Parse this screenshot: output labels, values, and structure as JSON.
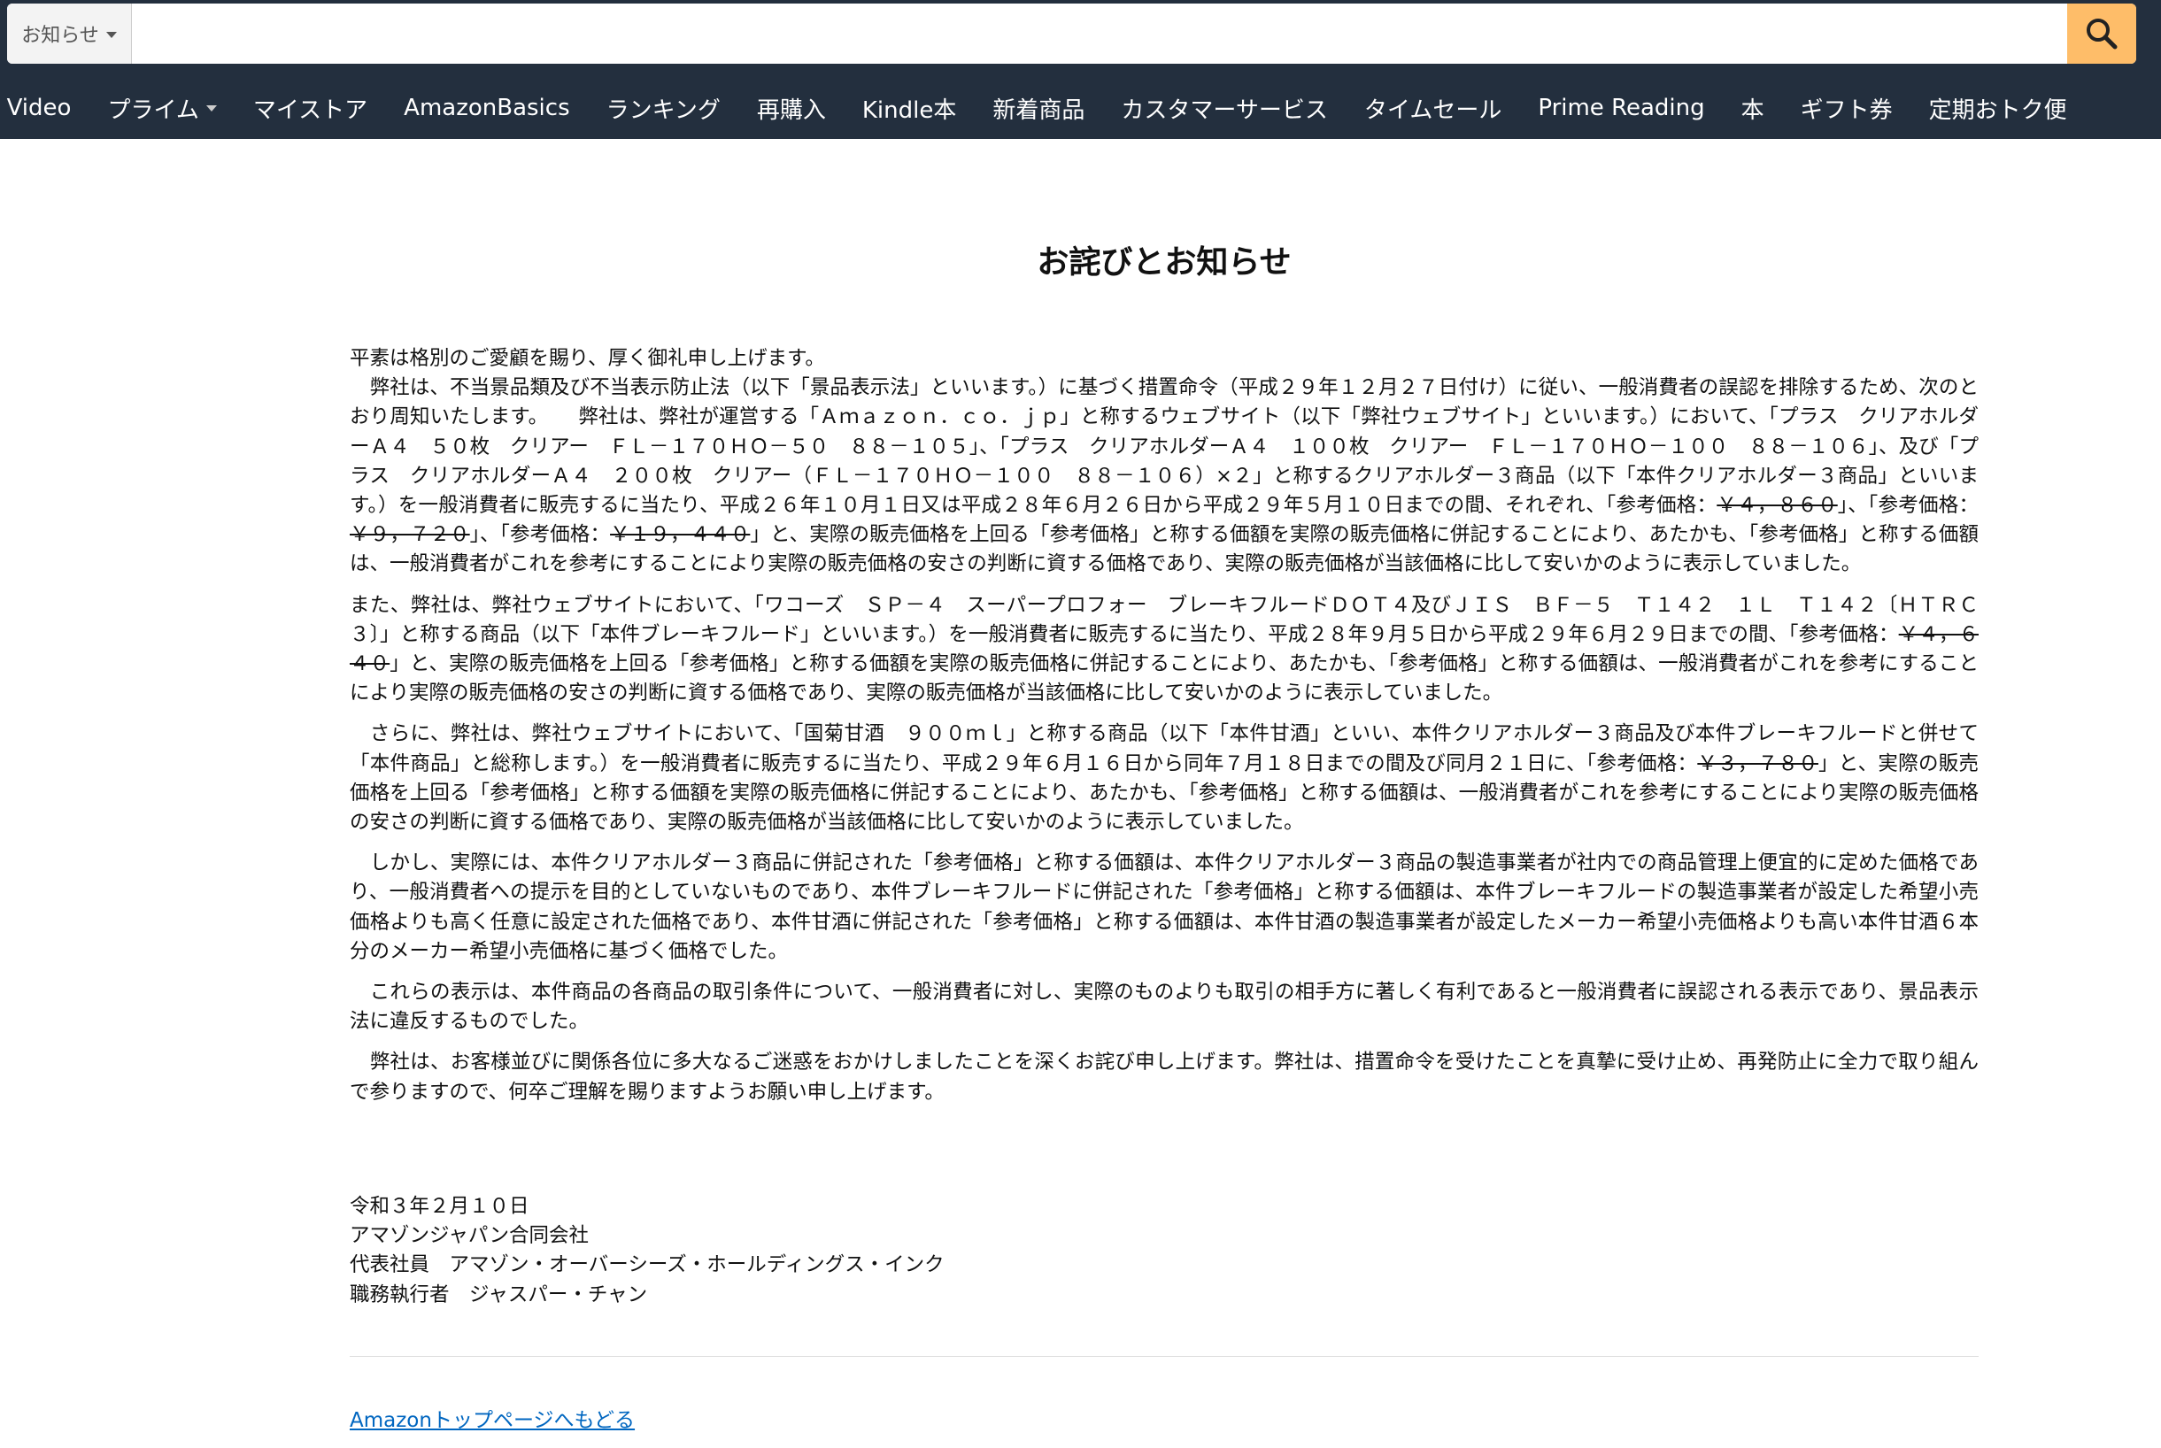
{
  "header": {
    "search": {
      "category": "お知らせ",
      "value": "",
      "placeholder": ""
    },
    "nav_items": [
      {
        "label": "me Video"
      },
      {
        "label": "プライム",
        "has_dropdown": true
      },
      {
        "label": "マイストア"
      },
      {
        "label": "AmazonBasics"
      },
      {
        "label": "ランキング"
      },
      {
        "label": "再購入"
      },
      {
        "label": "Kindle本"
      },
      {
        "label": "新着商品"
      },
      {
        "label": "カスタマーサービス"
      },
      {
        "label": "タイムセール"
      },
      {
        "label": "Prime Reading"
      },
      {
        "label": "本"
      },
      {
        "label": "ギフト券"
      },
      {
        "label": "定期おトク便"
      }
    ]
  },
  "colors": {
    "header_bg": "#232f3e",
    "search_button": "#febd69",
    "link": "#0066c0"
  },
  "main": {
    "title": "お詫びとお知らせ",
    "p1": {
      "line1": "平素は格別のご愛顧を賜り、厚く御礼申し上げます。",
      "a": "　弊社は、不当景品類及び不当表示防止法（以下「景品表示法」といいます。）に基づく措置命令（平成２９年１２月２７日付け）に従い、一般消費者の誤認を排除するため、次のとおり周知いたします。　　弊社は、弊社が運営する「Ａｍａｚｏｎ．ｃｏ．ｊｐ」と称するウェブサイト（以下「弊社ウェブサイト」といいます。）において、「プラス　クリアホルダーＡ４　５０枚　クリアー　ＦＬ－１７０ＨＯ－５０　８８－１０５」、「プラス　クリアホルダーＡ４　１００枚　クリアー　ＦＬ－１７０ＨＯ－１００　８８－１０６」、及び「プラス　クリアホルダーＡ４　２００枚　クリアー（ＦＬ－１７０ＨＯ－１００　８８－１０６）×２」と称するクリアホルダー３商品（以下「本件クリアホルダー３商品」といいます。）を一般消費者に販売するに当たり、平成２６年１０月１日又は平成２８年６月２６日から平成２９年５月１０日までの間、それぞれ、「参考価格：",
      "s1": "￥４，８６０",
      "b": "」、「参考価格：",
      "s2": "￥９，７２０",
      "c": "」、「参考価格：",
      "s3": "￥１９，４４０",
      "d": "」と、実際の販売価格を上回る「参考価格」と称する価額を実際の販売価格に併記することにより、あたかも、「参考価格」と称する価額は、一般消費者がこれを参考にすることにより実際の販売価格の安さの判断に資する価格であり、実際の販売価格が当該価格に比して安いかのように表示していました。"
    },
    "p2": {
      "a": "また、弊社は、弊社ウェブサイトにおいて、「ワコーズ　ＳＰ－４　スーパープロフォー　ブレーキフルードＤＯＴ４及びＪＩＳ　ＢＦ－５　Ｔ１４２　１Ｌ　Ｔ１４２〔ＨＴＲＣ３〕」と称する商品（以下「本件ブレーキフルード」といいます。）を一般消費者に販売するに当たり、平成２８年９月５日から平成２９年６月２９日までの間、「参考価格：",
      "s1": "￥４，６４０",
      "b": "」と、実際の販売価格を上回る「参考価格」と称する価額を実際の販売価格に併記することにより、あたかも、「参考価格」と称する価額は、一般消費者がこれを参考にすることにより実際の販売価格の安さの判断に資する価格であり、実際の販売価格が当該価格に比して安いかのように表示していました。"
    },
    "p3": {
      "a": "　さらに、弊社は、弊社ウェブサイトにおいて、「国菊甘酒　９００ｍｌ」と称する商品（以下「本件甘酒」といい、本件クリアホルダー３商品及び本件ブレーキフルードと併せて「本件商品」と総称します。）を一般消費者に販売するに当たり、平成２９年６月１６日から同年７月１８日までの間及び同月２１日に、「参考価格：",
      "s1": "￥３，７８０",
      "b": "」と、実際の販売価格を上回る「参考価格」と称する価額を実際の販売価格に併記することにより、あたかも、「参考価格」と称する価額は、一般消費者がこれを参考にすることにより実際の販売価格の安さの判断に資する価格であり、実際の販売価格が当該価格に比して安いかのように表示していました。"
    },
    "p4": "　しかし、実際には、本件クリアホルダー３商品に併記された「参考価格」と称する価額は、本件クリアホルダー３商品の製造事業者が社内での商品管理上便宜的に定めた価格であり、一般消費者への提示を目的としていないものであり、本件ブレーキフルードに併記された「参考価格」と称する価額は、本件ブレーキフルードの製造事業者が設定した希望小売価格よりも高く任意に設定された価格であり、本件甘酒に併記された「参考価格」と称する価額は、本件甘酒の製造事業者が設定したメーカー希望小売価格よりも高い本件甘酒６本分のメーカー希望小売価格に基づく価格でした。",
    "p5": "　これらの表示は、本件商品の各商品の取引条件について、一般消費者に対し、実際のものよりも取引の相手方に著しく有利であると一般消費者に誤認される表示であり、景品表示法に違反するものでした。",
    "p6": "　弊社は、お客様並びに関係各位に多大なるご迷惑をおかけしましたことを深くお詫び申し上げます。弊社は、措置命令を受けたことを真摯に受け止め、再発防止に全力で取り組んで参りますので、何卒ご理解を賜りますようお願い申し上げます。",
    "signature": {
      "date": "令和３年２月１０日",
      "company": "アマゾンジャパン合同会社",
      "rep1": "代表社員　アマゾン・オーバーシーズ・ホールディングス・インク",
      "rep2": "職務執行者　ジャスパー・チャン"
    },
    "back_link": "Amazonトップページへもどる"
  }
}
